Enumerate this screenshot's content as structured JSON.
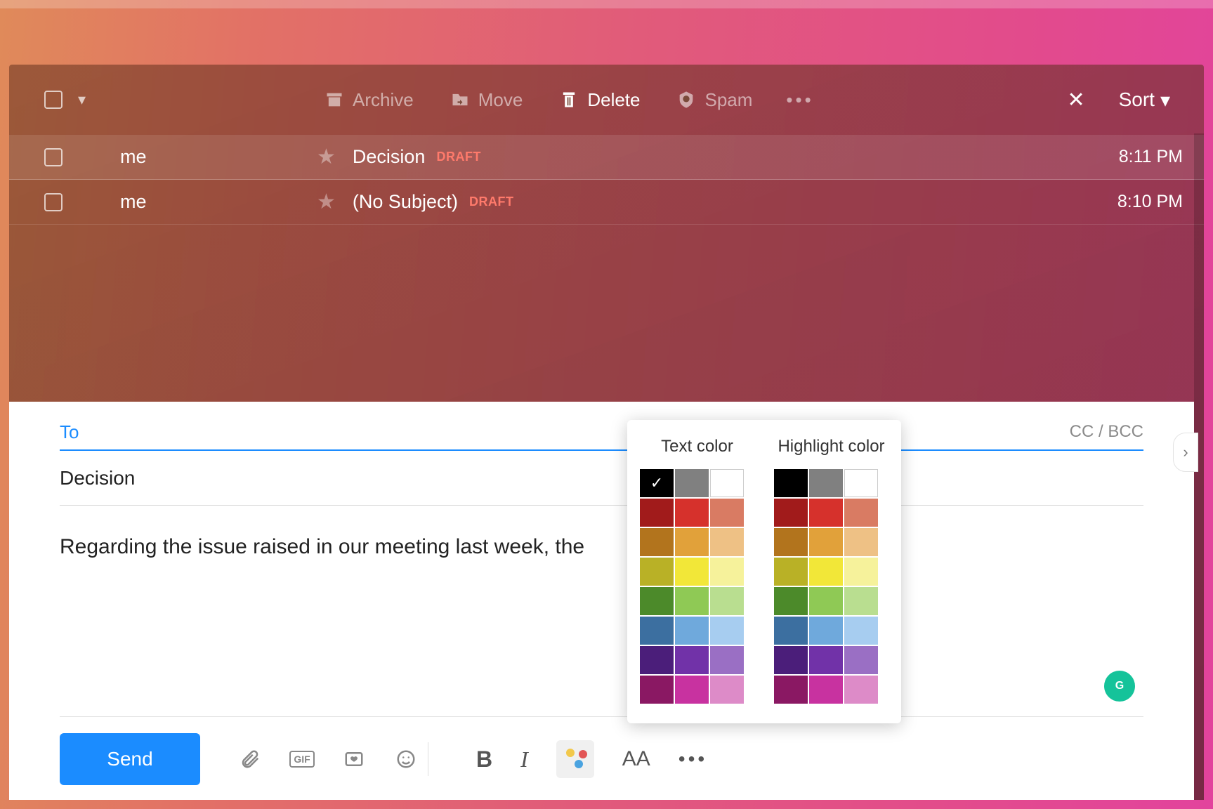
{
  "toolbar": {
    "archive": "Archive",
    "move": "Move",
    "delete": "Delete",
    "spam": "Spam",
    "sort": "Sort"
  },
  "messages": [
    {
      "sender": "me",
      "subject": "Decision",
      "draft": "DRAFT",
      "time": "8:11 PM",
      "selected": true
    },
    {
      "sender": "me",
      "subject": "(No Subject)",
      "draft": "DRAFT",
      "time": "8:10 PM",
      "selected": false
    }
  ],
  "compose": {
    "to_label": "To",
    "ccbcc": "CC / BCC",
    "subject": "Decision",
    "body": "Regarding the issue raised in our meeting last week, the",
    "send": "Send",
    "gif": "GIF",
    "font_size_label": "AA"
  },
  "popover": {
    "text_title": "Text color",
    "highlight_title": "Highlight color",
    "selected_text_color_index": 0,
    "colors": [
      "#000000",
      "#808080",
      "#ffffff",
      "#a11b1b",
      "#d6312c",
      "#d97b63",
      "#b2741d",
      "#e1a13a",
      "#eec185",
      "#b9b126",
      "#f2e738",
      "#f6f29b",
      "#4c8a2a",
      "#8fc955",
      "#b9de90",
      "#3c6fa0",
      "#6fa9dc",
      "#a7cdf0",
      "#4b1e7a",
      "#7132a8",
      "#9a6fc4",
      "#8a1863",
      "#c832a0",
      "#dd8bc8"
    ]
  },
  "grammarly": "G"
}
